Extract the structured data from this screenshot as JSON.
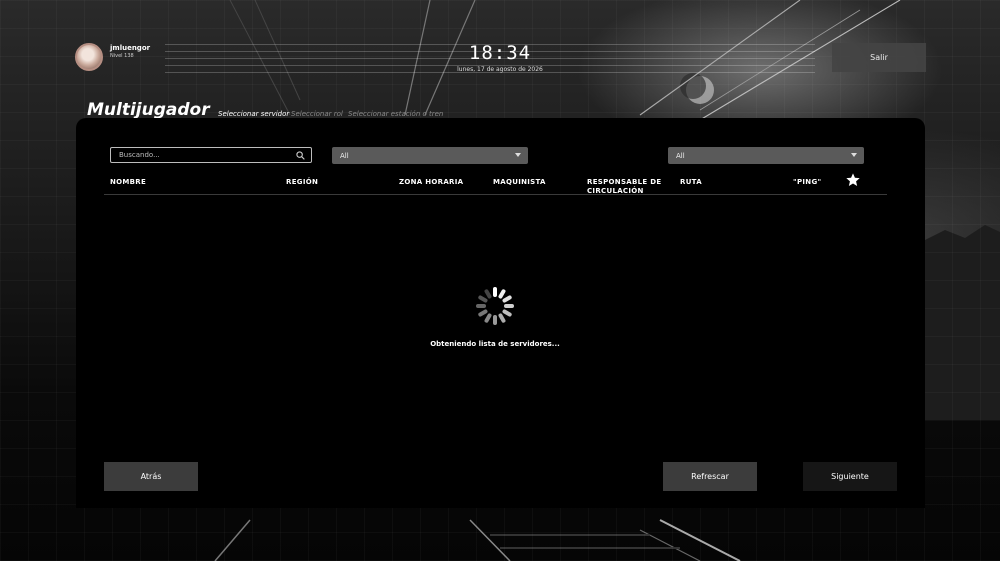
{
  "user": {
    "name": "jmluengor",
    "level": "Nivel 138"
  },
  "clock": {
    "time": "18:34",
    "date": "lunes, 17 de agosto de 2026"
  },
  "header": {
    "exit_label": "Salir",
    "title": "Multijugador"
  },
  "steps": [
    "Seleccionar servidor",
    "Seleccionar rol",
    "Seleccionar estación o tren"
  ],
  "filters": {
    "search_placeholder": "Buscando...",
    "region_select": "All",
    "route_select": "All"
  },
  "columns": [
    "NOMBRE",
    "REGIÓN",
    "ZONA HORARIA",
    "MAQUINISTA",
    "RESPONSABLE DE CIRCULACIÓN",
    "RUTA",
    "\"PING\""
  ],
  "status": {
    "loading": "Obteniendo lista de servidores..."
  },
  "footer": {
    "back_label": "Atrás",
    "refresh_label": "Refrescar",
    "next_label": "Siguiente"
  },
  "icons": {
    "search": "search-icon",
    "star": "star-icon",
    "spinner": "loading-spinner-icon",
    "chevron": "chevron-down-icon"
  },
  "colors": {
    "panel": "#000000",
    "button": "#3c3c3c",
    "select": "#5a5a5a"
  }
}
